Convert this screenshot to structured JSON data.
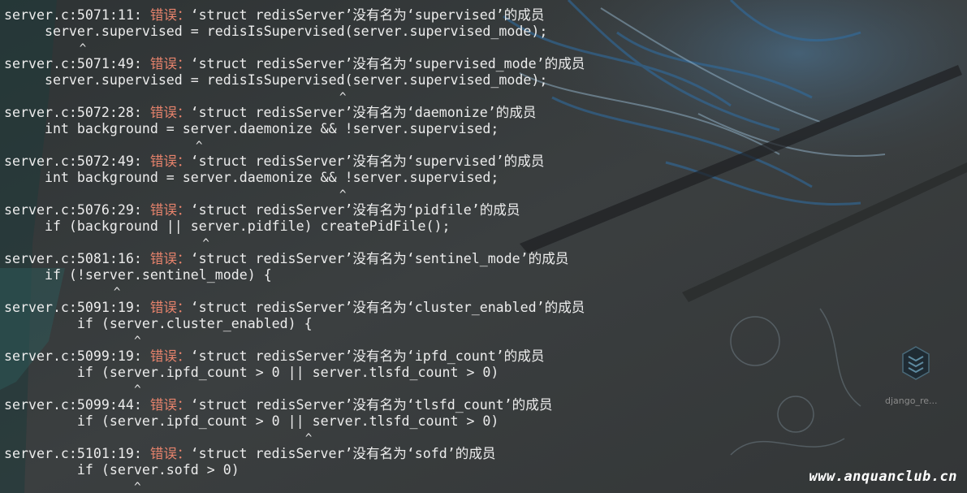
{
  "terminal": {
    "blocks": [
      {
        "location": "server.c:5071:11: ",
        "label": "错误：",
        "message": "‘struct redisServer’没有名为‘supervised’的成员",
        "code": "     server.supervised = redisIsSupervised(server.supervised_mode);",
        "caret": "           ^"
      },
      {
        "location": "server.c:5071:49: ",
        "label": "错误：",
        "message": "‘struct redisServer’没有名为‘supervised_mode’的成员",
        "code": "     server.supervised = redisIsSupervised(server.supervised_mode);",
        "caret": "                                                 ^"
      },
      {
        "location": "server.c:5072:28: ",
        "label": "错误：",
        "message": "‘struct redisServer’没有名为‘daemonize’的成员",
        "code": "     int background = server.daemonize && !server.supervised;",
        "caret": "                            ^"
      },
      {
        "location": "server.c:5072:49: ",
        "label": "错误：",
        "message": "‘struct redisServer’没有名为‘supervised’的成员",
        "code": "     int background = server.daemonize && !server.supervised;",
        "caret": "                                                 ^"
      },
      {
        "location": "server.c:5076:29: ",
        "label": "错误：",
        "message": "‘struct redisServer’没有名为‘pidfile’的成员",
        "code": "     if (background || server.pidfile) createPidFile();",
        "caret": "                             ^"
      },
      {
        "location": "server.c:5081:16: ",
        "label": "错误：",
        "message": "‘struct redisServer’没有名为‘sentinel_mode’的成员",
        "code": "     if (!server.sentinel_mode) {",
        "caret": "                ^"
      },
      {
        "location": "server.c:5091:19: ",
        "label": "错误：",
        "message": "‘struct redisServer’没有名为‘cluster_enabled’的成员",
        "code": "         if (server.cluster_enabled) {",
        "caret": "                   ^"
      },
      {
        "location": "server.c:5099:19: ",
        "label": "错误：",
        "message": "‘struct redisServer’没有名为‘ipfd_count’的成员",
        "code": "         if (server.ipfd_count > 0 || server.tlsfd_count > 0)",
        "caret": "                   ^"
      },
      {
        "location": "server.c:5099:44: ",
        "label": "错误：",
        "message": "‘struct redisServer’没有名为‘tlsfd_count’的成员",
        "code": "         if (server.ipfd_count > 0 || server.tlsfd_count > 0)",
        "caret": "                                            ^"
      },
      {
        "location": "server.c:5101:19: ",
        "label": "错误：",
        "message": "‘struct redisServer’没有名为‘sofd’的成员",
        "code": "         if (server.sofd > 0)",
        "caret": "                   ^"
      }
    ]
  },
  "desktop_icon": {
    "name": "django_re...",
    "icon": "cube-app-icon"
  },
  "watermark": {
    "text": "www.anquanclub.cn"
  },
  "colors": {
    "text": "#ececec",
    "error_label": "#e7836c",
    "background": "#3a3d3e"
  }
}
